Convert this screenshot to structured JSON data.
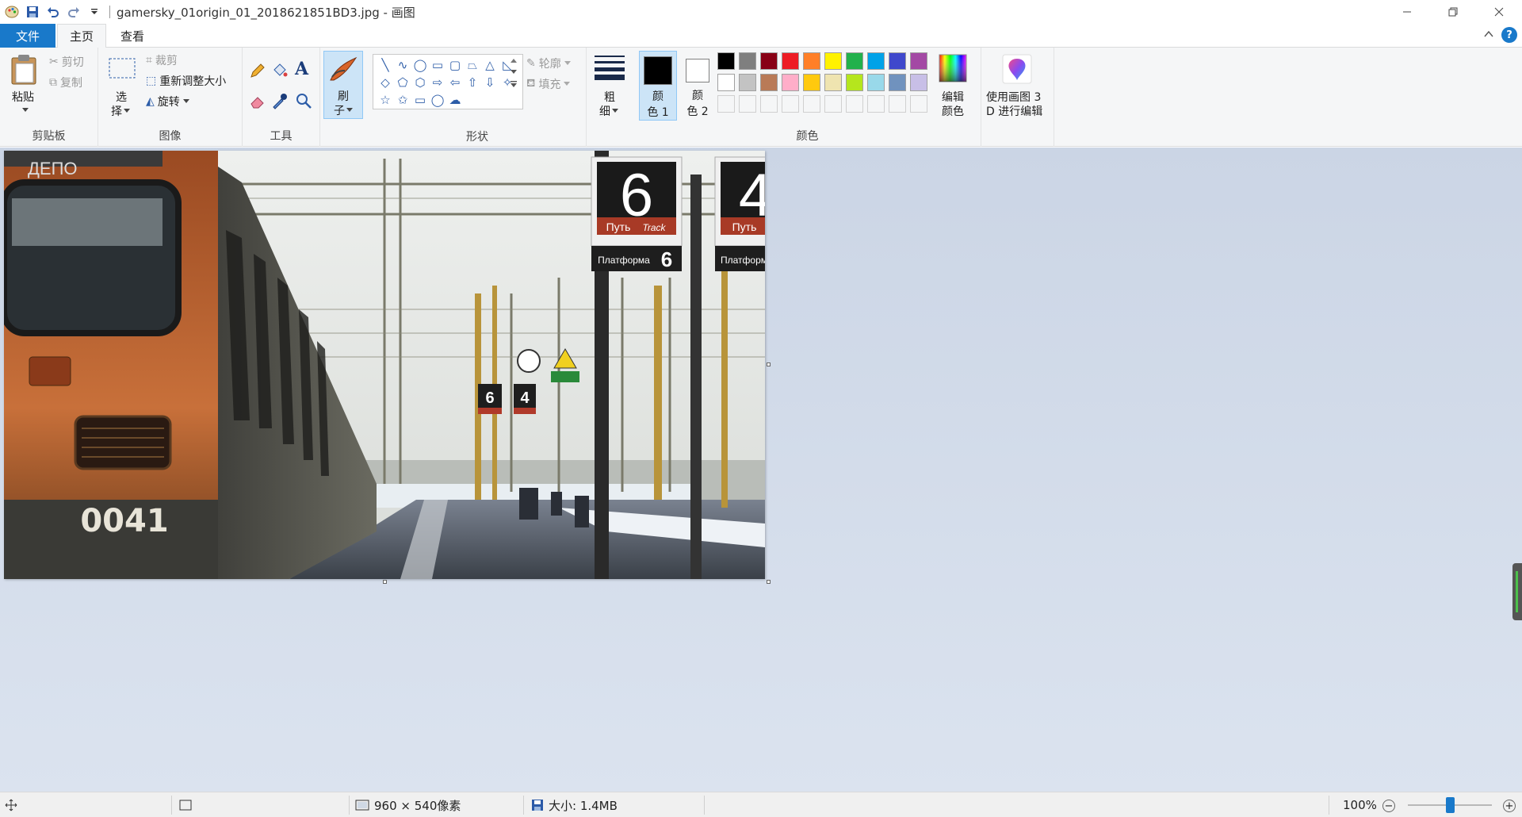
{
  "window": {
    "title": "gamersky_01origin_01_2018621851BD3.jpg - 画图"
  },
  "tabs": [
    {
      "label": "文件"
    },
    {
      "label": "主页"
    },
    {
      "label": "查看"
    }
  ],
  "clipboard": {
    "paste": "粘贴",
    "cut": "剪切",
    "copy": "复制",
    "group": "剪贴板"
  },
  "image": {
    "select_line1": "选",
    "select_line2": "择",
    "crop": "裁剪",
    "resize": "重新调整大小",
    "rotate": "旋转",
    "group": "图像"
  },
  "tools": {
    "text_glyph": "A",
    "group": "工具"
  },
  "brushes": {
    "line1": "刷",
    "line2": "子"
  },
  "shapes": {
    "outline": "轮廓",
    "fill": "填充",
    "group": "形状",
    "items": [
      "╲",
      "∿",
      "◯",
      "▭",
      "▢",
      "⏢",
      "△",
      "◺",
      "◇",
      "⬠",
      "⬡",
      "⇨",
      "⇦",
      "⇧",
      "⇩",
      "✧",
      "☆",
      "✩",
      "▭",
      "◯",
      "☁"
    ]
  },
  "size": {
    "line1": "粗",
    "line2": "细"
  },
  "colors": {
    "color1_line1": "颜",
    "color1_line2": "色 1",
    "color2_line1": "颜",
    "color2_line2": "色 2",
    "edit_line1": "编辑",
    "edit_line2": "颜色",
    "group": "颜色",
    "color1": "#000000",
    "color2": "#ffffff",
    "palette": [
      "#000000",
      "#7f7f7f",
      "#880015",
      "#ed1c24",
      "#ff7f27",
      "#fff200",
      "#22b14c",
      "#00a2e8",
      "#3f48cc",
      "#a349a4",
      "#ffffff",
      "#c3c3c3",
      "#b97a57",
      "#ffaec9",
      "#ffc90e",
      "#efe4b0",
      "#b5e61d",
      "#99d9ea",
      "#7092be",
      "#c8bfe7",
      "#f5f6f7",
      "#f5f6f7",
      "#f5f6f7",
      "#f5f6f7",
      "#f5f6f7",
      "#f5f6f7",
      "#f5f6f7",
      "#f5f6f7",
      "#f5f6f7",
      "#f5f6f7"
    ]
  },
  "paint3d": {
    "line1": "使用画图 3",
    "line2": "D 进行编辑"
  },
  "photo": {
    "depot": "ДЕПО",
    "train_number": "0041",
    "sign_big_number": "6",
    "sign_track_ru": "Путь",
    "sign_track_en": "Track",
    "sign_platform": "Платформа",
    "sign_platform_number": "6",
    "sign2_number": "4",
    "sign2_track_ru": "Путь",
    "sign2_platform": "Платформ",
    "small_sign1": "6",
    "small_sign2": "4"
  },
  "status": {
    "dimensions": "960 × 540像素",
    "filesize": "大小: 1.4MB",
    "zoom": "100%",
    "zoom_level": 0.5
  }
}
